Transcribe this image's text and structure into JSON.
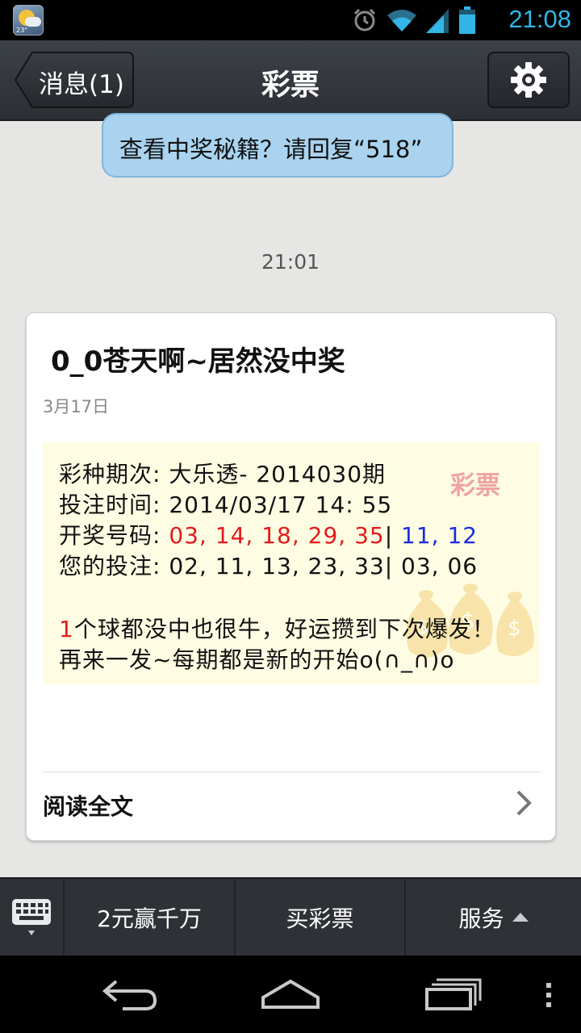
{
  "status_bar": {
    "weather_temp": "23°",
    "time": "21:08",
    "icons": [
      "alarm-icon",
      "wifi-icon",
      "signal-icon",
      "battery-icon"
    ]
  },
  "header": {
    "back_label": "消息(1)",
    "title": "彩票",
    "settings_icon": "gear-icon"
  },
  "chat": {
    "bubble_text": "查看中奖秘籍？请回复“518”",
    "timestamp": "21:01"
  },
  "card": {
    "title": "0_0苍天啊~居然没中奖",
    "date": "3月17日",
    "watermark": "彩票",
    "lines": {
      "lottery_label": "彩种期次: ",
      "lottery_value": "大乐透- 2014030期",
      "time_label": "投注时间: ",
      "time_value": "2014/03/17  14: 55",
      "draw_label": "开奖号码: ",
      "draw_red": "03, 14, 18, 29, 35",
      "draw_sep": "| ",
      "draw_blue": "11, 12",
      "bet_label": "您的投注: ",
      "bet_value": "02, 11, 13, 23, 33| 03, 06",
      "msg1_count": "1",
      "msg1_rest": "个球都没中也很牛，好运攒到下次爆发！",
      "msg2": "再来一发~每期都是新的开始o(∩_∩)o"
    },
    "read_more": "阅读全文"
  },
  "menu": {
    "item1": "2元赢千万",
    "item2": "买彩票",
    "item3": "服务"
  },
  "colors": {
    "accent_time": "#33b5e5",
    "bubble": "#a9d3ef",
    "draw_red": "#e21b1b",
    "draw_blue": "#1a2ee0",
    "card_body": "#fefde4"
  }
}
